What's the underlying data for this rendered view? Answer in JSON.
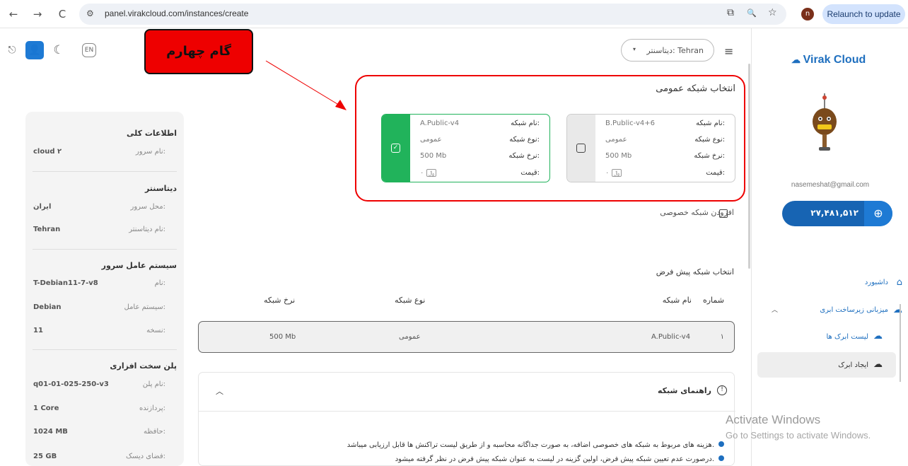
{
  "browser": {
    "url": "panel.virakcloud.com/instances/create",
    "relaunch_label": "Relaunch to update",
    "profile_initial": "n",
    "back_icon": "←",
    "forward_icon": "→",
    "reload_icon": "C",
    "site_icon": "⚙",
    "install_icon": "⧉",
    "zoom_icon": "🔍",
    "star_icon": "☆"
  },
  "toolbar": {
    "lang_label": "EN",
    "moon_icon": "☾",
    "user_icon": "👤",
    "logout_icon": "⎋"
  },
  "annotation": {
    "step_label": "گام چهارم"
  },
  "header": {
    "datacenter_label": "دیتاسنتر: Tehran",
    "caret": "▾",
    "menu_icon": "≡"
  },
  "sidebar": {
    "logo_text": "Virak Cloud",
    "email": "nasemeshat@gmail.com",
    "balance": "۲۷,۴۸۱,۵۱۲",
    "menu": [
      {
        "label": "داشبورد"
      },
      {
        "label": "میزبانی زیرساخت ابری"
      },
      {
        "label": "لیست ابرک ها"
      },
      {
        "label": "ایجاد ابرک"
      }
    ]
  },
  "summary": {
    "general_title": "اطلاعات کلی",
    "server_name_key": "نام سرور:",
    "server_name_val": "cloud ۲",
    "dc_title": "دیتاسنتر",
    "location_key": "محل سرور:",
    "location_val": "ایران",
    "dc_name_key": "نام دیتاسنتر:",
    "dc_name_val": "Tehran",
    "os_title": "سیستم عامل سرور",
    "os_name_key": "نام:",
    "os_name_val": "T-Debian11-7-v8",
    "os_key": "سیستم عامل:",
    "os_val": "Debian",
    "version_key": "نسخه:",
    "version_val": "11",
    "hw_title": "پلن سخت افزاری",
    "plan_key": "نام پلن:",
    "plan_val": "q01-01-025-250-v3",
    "cpu_key": "پردازنده:",
    "cpu_val": "1 Core",
    "ram_key": "حافظه:",
    "ram_val": "1024 MB",
    "disk_key": "فضای دیسک:",
    "disk_val": "25 GB"
  },
  "public_network": {
    "title": "انتخاب شبکه عمومی",
    "cards": [
      {
        "name_key": "نام شبکه:",
        "name": "B.Public-v4+6",
        "type_key": "نوع شبکه:",
        "type": "عمومی",
        "rate_key": "نرخ شبکه:",
        "rate": "500 Mb",
        "price_key": "قیمت:",
        "price": "۰",
        "selected": false
      },
      {
        "name_key": "نام شبکه:",
        "name": "A.Public-v4",
        "type_key": "نوع شبکه:",
        "type": "عمومی",
        "rate_key": "نرخ شبکه:",
        "rate": "500 Mb",
        "price_key": "قیمت:",
        "price": "۰",
        "selected": true
      }
    ],
    "add_private_label": "افزودن شبکه خصوصی"
  },
  "default_network": {
    "title": "انتخاب شبکه پیش فرض",
    "headers": {
      "number": "شماره",
      "name": "نام شبکه",
      "type": "نوع شبکه",
      "rate": "نرخ شبکه"
    },
    "row": {
      "number": "۱",
      "name": "A.Public-v4",
      "type": "عمومی",
      "rate": "500 Mb"
    }
  },
  "guide": {
    "title": "راهنمای شبکه",
    "lines": [
      "هزینه های مربوط به شبکه های خصوصی اضافه، به صورت جداگانه محاسبه و از طریق لیست تراکنش ها قابل ارزیابی میباشد.",
      "درصورت عدم تعیین شبکه پیش فرض، اولین گزینه در لیست به عنوان شبکه پیش فرض در نظر گرفته میشود."
    ]
  },
  "watermark": {
    "line1": "Activate Windows",
    "line2": "Go to Settings to activate Windows."
  },
  "colors": {
    "accent": "#1e7ad4",
    "selected": "#21b35b",
    "highlight": "#ee0000"
  }
}
